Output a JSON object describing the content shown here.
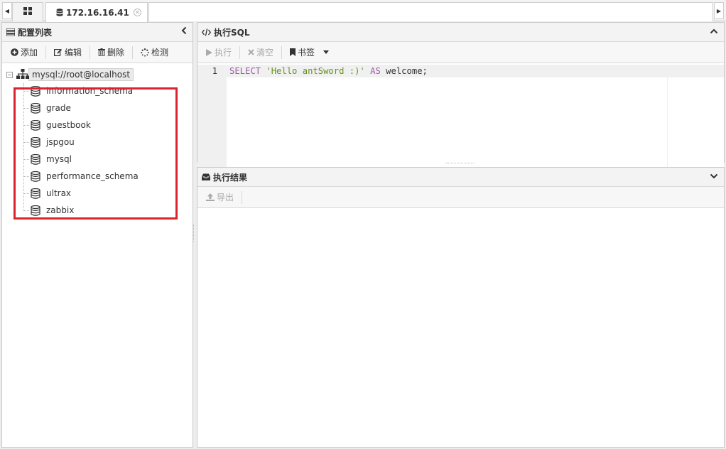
{
  "tabs": {
    "home_icon": "grid-icon",
    "active_tab_label": "172.16.16.41",
    "active_tab_icon": "database-icon"
  },
  "config_panel": {
    "title": "配置列表",
    "toolbar": {
      "add_label": "添加",
      "edit_label": "编辑",
      "delete_label": "删除",
      "check_label": "检测"
    },
    "tree": {
      "root_label": "mysql://root@localhost",
      "databases": [
        "information_schema",
        "grade",
        "guestbook",
        "jspgou",
        "mysql",
        "performance_schema",
        "ultrax",
        "zabbix"
      ]
    }
  },
  "sql_panel": {
    "title": "执行SQL",
    "toolbar": {
      "run_label": "执行",
      "clear_label": "清空",
      "bookmark_label": "书签"
    },
    "editor": {
      "line_number": "1",
      "kw_select": "SELECT",
      "string_literal": "'Hello antSword :)'",
      "kw_as": "AS",
      "rest": " welcome;"
    }
  },
  "result_panel": {
    "title": "执行结果",
    "toolbar": {
      "export_label": "导出"
    }
  },
  "colors": {
    "highlight_border": "#d9262c",
    "keyword": "#a05ca6",
    "string": "#67901f"
  }
}
